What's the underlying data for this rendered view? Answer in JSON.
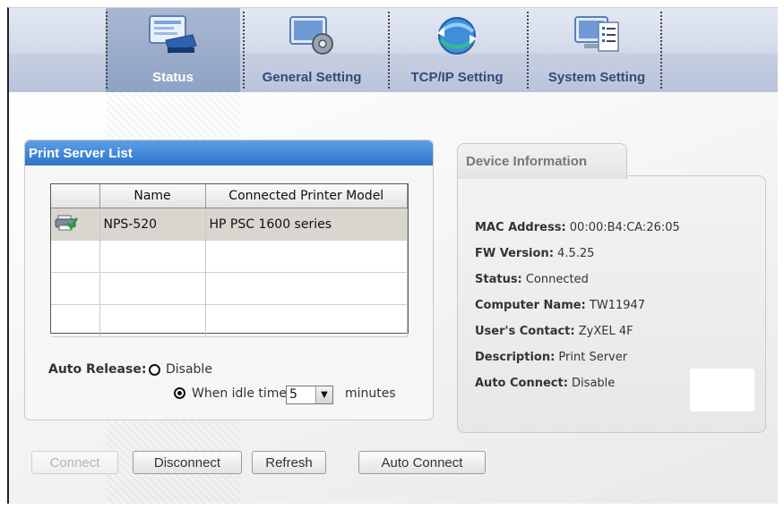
{
  "tabs": [
    {
      "label": "Status",
      "active": true
    },
    {
      "label": "General Setting"
    },
    {
      "label": "TCP/IP Setting"
    },
    {
      "label": "System Setting"
    }
  ],
  "print_server_list": {
    "title": "Print Server List",
    "columns": [
      "",
      "Name",
      "Connected Printer Model"
    ],
    "rows": [
      {
        "name": "NPS-520",
        "model": "HP PSC 1600 series"
      }
    ],
    "empty_rows": 3
  },
  "auto_release": {
    "label": "Auto Release:",
    "disable_label": "Disable",
    "idle_label": "When idle time",
    "idle_value": "5",
    "minutes_label": "minutes",
    "selected": "idle"
  },
  "device_info": {
    "title": "Device Information",
    "fields": [
      {
        "label": "MAC Address:",
        "value": "00:00:B4:CA:26:05"
      },
      {
        "label": "FW Version:",
        "value": "4.5.25"
      },
      {
        "label": "Status:",
        "value": "Connected"
      },
      {
        "label": "Computer Name:",
        "value": "TW11947"
      },
      {
        "label": "User's Contact:",
        "value": "ZyXEL 4F"
      },
      {
        "label": "Description:",
        "value": "Print Server"
      },
      {
        "label": "Auto Connect:",
        "value": "Disable"
      }
    ]
  },
  "buttons": {
    "connect": "Connect",
    "disconnect": "Disconnect",
    "refresh": "Refresh",
    "auto_connect": "Auto Connect"
  },
  "colors": {
    "header_blue": "#2f74c9",
    "tab_text": "#344a78",
    "active_tab": "#8ea2c4"
  }
}
